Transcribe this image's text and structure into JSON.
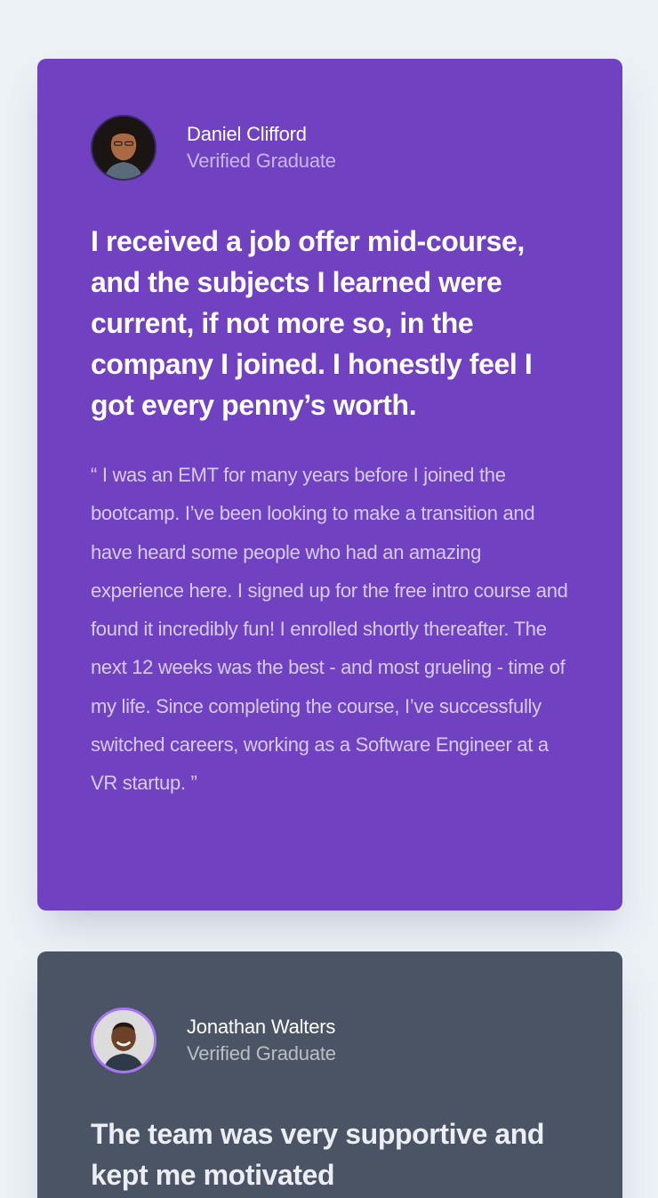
{
  "testimonials": [
    {
      "name": "Daniel Clifford",
      "role": "Verified Graduate",
      "headline": "I received a job offer mid-course, and the subjects I learned were current, if not more so, in the company I joined. I honestly feel I got every penny’s worth.",
      "quote": "“ I was an EMT for many years before I joined the bootcamp. I’ve been looking to make a transition and have heard some people who had an amazing experience here. I signed up for the free intro course and found it incredibly fun! I enrolled shortly thereafter. The next 12 weeks was the best - and most grueling - time of my life. Since completing the course, I’ve successfully switched careers, working as a Software Engineer at a VR startup. ”",
      "background_color": "#7041c0"
    },
    {
      "name": "Jonathan Walters",
      "role": "Verified Graduate",
      "headline": "The team was very supportive and kept me motivated",
      "background_color": "#4a5465"
    }
  ]
}
